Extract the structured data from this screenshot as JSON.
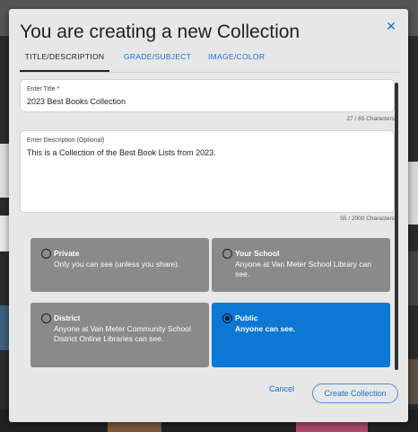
{
  "modal": {
    "title": "You are creating a new Collection",
    "close_icon": "close-icon",
    "close_glyph": "✕"
  },
  "tabs": [
    {
      "label": "TITLE/DESCRIPTION",
      "active": true
    },
    {
      "label": "GRADE/SUBJECT",
      "active": false
    },
    {
      "label": "IMAGE/COLOR",
      "active": false
    }
  ],
  "title_field": {
    "label": "Enter Title *",
    "value": "2023 Best Books Collection",
    "counter": "27 / 65 Characters"
  },
  "description_field": {
    "label": "Enter Description (Optional)",
    "value": "This is a Collection of the Best Book Lists from 2023.",
    "counter": "55 / 2000 Characters"
  },
  "visibility_options": [
    {
      "name": "Private",
      "description": "Only you can see (unless you share).",
      "selected": false
    },
    {
      "name": "Your School",
      "description": "Anyone at Van Meter School Library can see.",
      "selected": false
    },
    {
      "name": "District",
      "description": "Anyone at Van Meter Community School District Online Libraries can see.",
      "selected": false
    },
    {
      "name": "Public",
      "description": "Anyone can see.",
      "selected": true
    }
  ],
  "footer": {
    "cancel_label": "Cancel",
    "create_label": "Create Collection"
  },
  "colors": {
    "accent": "#1a6fd0",
    "selected_option": "#0b78d6",
    "unselected_option": "#8a8a8a",
    "modal_bg": "#e7e7e7"
  }
}
